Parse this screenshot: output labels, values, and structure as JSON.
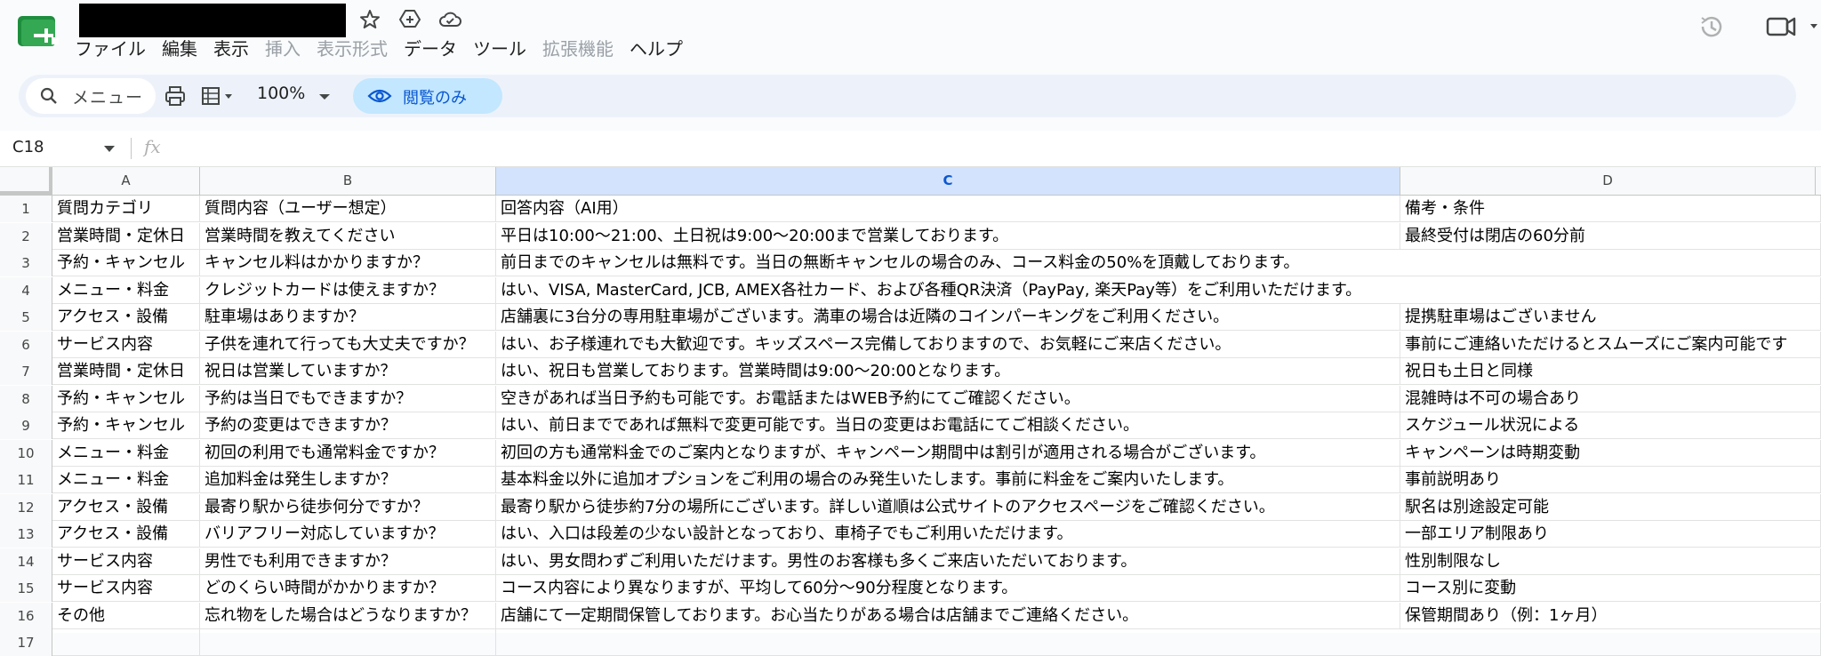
{
  "app": {
    "menu": [
      {
        "label": "ファイル",
        "disabled": false
      },
      {
        "label": "編集",
        "disabled": false
      },
      {
        "label": "表示",
        "disabled": false
      },
      {
        "label": "挿入",
        "disabled": true
      },
      {
        "label": "表示形式",
        "disabled": true
      },
      {
        "label": "データ",
        "disabled": false
      },
      {
        "label": "ツール",
        "disabled": false
      },
      {
        "label": "拡張機能",
        "disabled": true
      },
      {
        "label": "ヘルプ",
        "disabled": false
      }
    ]
  },
  "toolbar": {
    "search_label": "メニュー",
    "zoom": "100%",
    "view_only_label": "閲覧のみ"
  },
  "formula_bar": {
    "name_box": "C18",
    "fx": "fx"
  },
  "grid": {
    "columns": [
      "A",
      "B",
      "C",
      "D"
    ],
    "selected_column": "C",
    "rows": [
      {
        "n": "1",
        "a": "質問カテゴリ",
        "b": "質問内容（ユーザー想定）",
        "c": "回答内容（AI用）",
        "d": "備考・条件"
      },
      {
        "n": "2",
        "a": "営業時間・定休日",
        "b": "営業時間を教えてください",
        "c": "平日は10:00〜21:00、土日祝は9:00〜20:00まで営業しております。",
        "d": "最終受付は閉店の60分前"
      },
      {
        "n": "3",
        "a": "予約・キャンセル",
        "b": "キャンセル料はかかりますか？",
        "c": "前日までのキャンセルは無料です。当日の無断キャンセルの場合のみ、コース料金の50%を頂戴しております。",
        "d": ""
      },
      {
        "n": "4",
        "a": "メニュー・料金",
        "b": "クレジットカードは使えますか？",
        "c": "はい、VISA, MasterCard, JCB, AMEX各社カード、および各種QR決済（PayPay, 楽天Pay等）をご利用いただけます。",
        "d": ""
      },
      {
        "n": "5",
        "a": "アクセス・設備",
        "b": "駐車場はありますか？",
        "c": "店舗裏に3台分の専用駐車場がございます。満車の場合は近隣のコインパーキングをご利用ください。",
        "d": "提携駐車場はございません"
      },
      {
        "n": "6",
        "a": "サービス内容",
        "b": "子供を連れて行っても大丈夫ですか？",
        "c": "はい、お子様連れでも大歓迎です。キッズスペース完備しておりますので、お気軽にご来店ください。",
        "d": "事前にご連絡いただけるとスムーズにご案内可能です"
      },
      {
        "n": "7",
        "a": "営業時間・定休日",
        "b": "祝日は営業していますか？",
        "c": "はい、祝日も営業しております。営業時間は9:00〜20:00となります。",
        "d": "祝日も土日と同様"
      },
      {
        "n": "8",
        "a": "予約・キャンセル",
        "b": "予約は当日でもできますか？",
        "c": "空きがあれば当日予約も可能です。お電話またはWEB予約にてご確認ください。",
        "d": "混雑時は不可の場合あり"
      },
      {
        "n": "9",
        "a": "予約・キャンセル",
        "b": "予約の変更はできますか？",
        "c": "はい、前日までであれば無料で変更可能です。当日の変更はお電話にてご相談ください。",
        "d": "スケジュール状況による"
      },
      {
        "n": "10",
        "a": "メニュー・料金",
        "b": "初回の利用でも通常料金ですか？",
        "c": "初回の方も通常料金でのご案内となりますが、キャンペーン期間中は割引が適用される場合がございます。",
        "d": "キャンペーンは時期変動"
      },
      {
        "n": "11",
        "a": "メニュー・料金",
        "b": "追加料金は発生しますか？",
        "c": "基本料金以外に追加オプションをご利用の場合のみ発生いたします。事前に料金をご案内いたします。",
        "d": "事前説明あり"
      },
      {
        "n": "12",
        "a": "アクセス・設備",
        "b": "最寄り駅から徒歩何分ですか？",
        "c": "最寄り駅から徒歩約7分の場所にございます。詳しい道順は公式サイトのアクセスページをご確認ください。",
        "d": "駅名は別途設定可能"
      },
      {
        "n": "13",
        "a": "アクセス・設備",
        "b": "バリアフリー対応していますか？",
        "c": "はい、入口は段差の少ない設計となっており、車椅子でもご利用いただけます。",
        "d": "一部エリア制限あり"
      },
      {
        "n": "14",
        "a": "サービス内容",
        "b": "男性でも利用できますか？",
        "c": "はい、男女問わずご利用いただけます。男性のお客様も多くご来店いただいております。",
        "d": "性別制限なし"
      },
      {
        "n": "15",
        "a": "サービス内容",
        "b": "どのくらい時間がかかりますか？",
        "c": "コース内容により異なりますが、平均して60分〜90分程度となります。",
        "d": "コース別に変動"
      },
      {
        "n": "16",
        "a": "その他",
        "b": "忘れ物をした場合はどうなりますか？",
        "c": "店舗にて一定期間保管しております。お心当たりがある場合は店舗までご連絡ください。",
        "d": "保管期間あり（例：1ヶ月）"
      },
      {
        "n": "17",
        "a": "",
        "b": "",
        "c": "",
        "d": ""
      }
    ]
  },
  "colors": {
    "accent": "#0b57d0",
    "view_only_bg": "#c2e7ff",
    "toolbar_bg": "#edf2fa",
    "selected_column_bg": "#d3e3fd",
    "sheets_green": "#34a853"
  }
}
